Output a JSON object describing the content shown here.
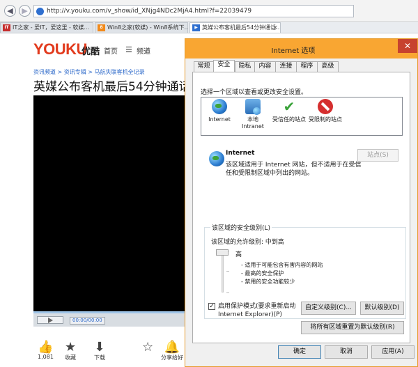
{
  "browser": {
    "url": "http://v.youku.com/v_show/id_XNjg4NDc2MjA4.html?f=22039479",
    "tabs": [
      {
        "icon": "IT",
        "label": "IT之家 - 爱IT，爱这里 - 软媒..."
      },
      {
        "icon": "8",
        "label": "Win8之家(软媒) - Win8系统下..."
      },
      {
        "icon": "▶",
        "label": "英媒公布客机最后54分钟通话..."
      }
    ],
    "tab_close": "×",
    "back_glyph": "◀",
    "forward_glyph": "▶"
  },
  "page": {
    "logo_text": "YOUKU",
    "logo_cn": "优酷",
    "nav_home": "首页",
    "nav_menu_glyph": "☰",
    "nav_channels": "频道",
    "breadcrumb": "资讯频道 > 资讯专辑 > 马航失联客机全记录",
    "video_title": "英媒公布客机最后54分钟通话",
    "time_display": "00:00/00:00",
    "actions": [
      {
        "icon": "thumbs-up-icon",
        "glyph": "👍",
        "label": "1,081"
      },
      {
        "icon": "star-icon",
        "glyph": "★",
        "label": "收藏"
      },
      {
        "icon": "download-icon",
        "glyph": "⬇",
        "label": "下载"
      },
      {
        "icon": "star-sparkle-icon",
        "glyph": "☆",
        "label": ""
      },
      {
        "icon": "bell-icon",
        "glyph": "🔔",
        "label": ""
      },
      {
        "icon": "share-icon",
        "glyph": "⤴",
        "label": "分享给好"
      }
    ]
  },
  "dialog": {
    "title": "Internet 选项",
    "close_glyph": "✕",
    "tabs": [
      "常规",
      "安全",
      "隐私",
      "内容",
      "连接",
      "程序",
      "高级"
    ],
    "active_tab": "安全",
    "zone_instruction": "选择一个区域以查看或更改安全设置。",
    "zones": [
      {
        "label": "Internet"
      },
      {
        "label": "本地 Intranet"
      },
      {
        "label": "受信任的站点"
      },
      {
        "label": "受限制的站点"
      }
    ],
    "selected_zone": "Internet",
    "zone_detail": {
      "name": "Internet",
      "description": "该区域适用于 Internet 网站，但不适用于在受信任和受限制区域中列出的网站。"
    },
    "sites_button": "站点(S)",
    "level_group_title": "该区域的安全级别(L)",
    "allowed_levels": "该区域的允许级别: 中到高",
    "level_name": "高",
    "level_bullets": [
      "- 适用于可能包含有害内容的网站",
      "- 最高的安全保护",
      "- 禁用的安全功能较少"
    ],
    "protected_mode": {
      "checked": true,
      "check_glyph": "✓",
      "label": "启用保护模式(要求重新启动 Internet Explorer)(P)"
    },
    "custom_level_button": "自定义级别(C)...",
    "default_level_button": "默认级别(D)",
    "reset_all_button": "将所有区域重置为默认级别(R)",
    "ok_button": "确定",
    "cancel_button": "取消",
    "apply_button": "应用(A)"
  },
  "colors": {
    "dialog_title_bar": "#f9a632",
    "close_button": "#c7422f",
    "youku_red": "#e23b1e",
    "link_blue": "#2a67c9"
  }
}
